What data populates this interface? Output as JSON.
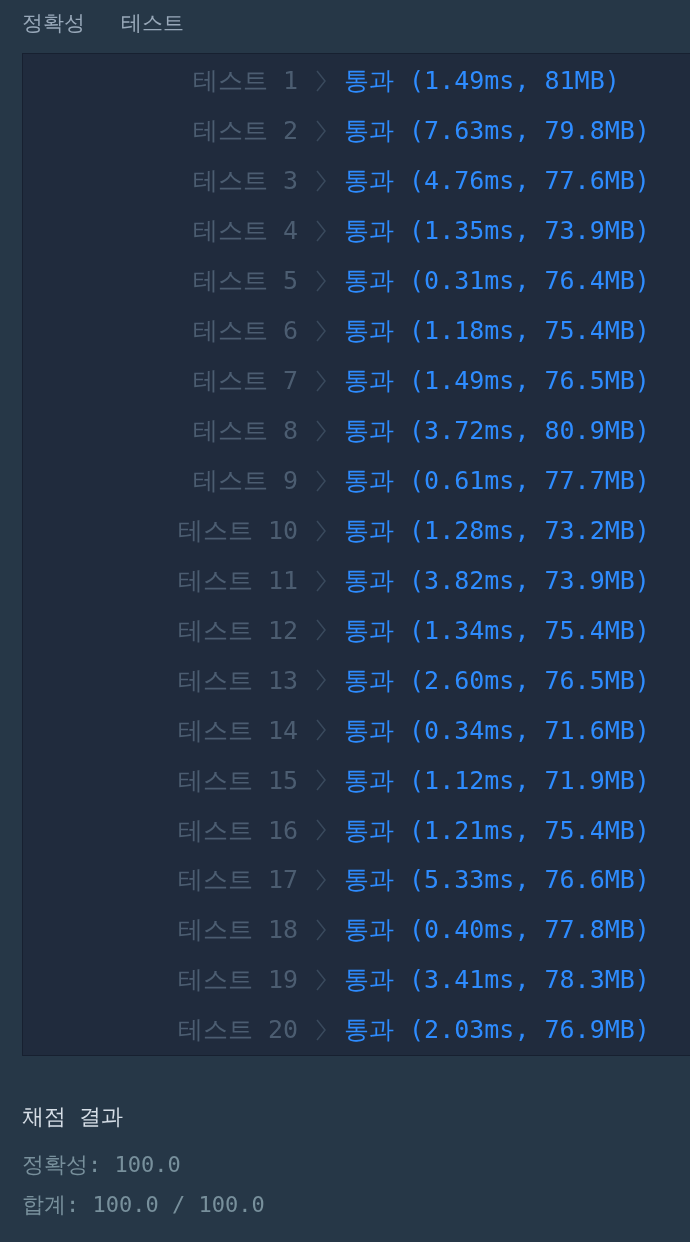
{
  "header": {
    "title": "정확성",
    "subtitle": "테스트"
  },
  "tests": [
    {
      "label": "테스트 1",
      "result": "통과 (1.49ms, 81MB)",
      "kind": "pass"
    },
    {
      "label": "테스트 2",
      "result": "통과 (7.63ms, 79.8MB)",
      "kind": "pass"
    },
    {
      "label": "테스트 3",
      "result": "통과 (4.76ms, 77.6MB)",
      "kind": "pass"
    },
    {
      "label": "테스트 4",
      "result": "통과 (1.35ms, 73.9MB)",
      "kind": "pass"
    },
    {
      "label": "테스트 5",
      "result": "통과 (0.31ms, 76.4MB)",
      "kind": "pass"
    },
    {
      "label": "테스트 6",
      "result": "통과 (1.18ms, 75.4MB)",
      "kind": "pass"
    },
    {
      "label": "테스트 7",
      "result": "통과 (1.49ms, 76.5MB)",
      "kind": "pass"
    },
    {
      "label": "테스트 8",
      "result": "통과 (3.72ms, 80.9MB)",
      "kind": "pass"
    },
    {
      "label": "테스트 9",
      "result": "통과 (0.61ms, 77.7MB)",
      "kind": "pass"
    },
    {
      "label": "테스트 10",
      "result": "통과 (1.28ms, 73.2MB)",
      "kind": "pass"
    },
    {
      "label": "테스트 11",
      "result": "통과 (3.82ms, 73.9MB)",
      "kind": "pass"
    },
    {
      "label": "테스트 12",
      "result": "통과 (1.34ms, 75.4MB)",
      "kind": "pass"
    },
    {
      "label": "테스트 13",
      "result": "통과 (2.60ms, 76.5MB)",
      "kind": "pass"
    },
    {
      "label": "테스트 14",
      "result": "통과 (0.34ms, 71.6MB)",
      "kind": "pass"
    },
    {
      "label": "테스트 15",
      "result": "통과 (1.12ms, 71.9MB)",
      "kind": "pass"
    },
    {
      "label": "테스트 16",
      "result": "통과 (1.21ms, 75.4MB)",
      "kind": "pass"
    },
    {
      "label": "테스트 17",
      "result": "통과 (5.33ms, 76.6MB)",
      "kind": "pass"
    },
    {
      "label": "테스트 18",
      "result": "통과 (0.40ms, 77.8MB)",
      "kind": "pass"
    },
    {
      "label": "테스트 19",
      "result": "통과 (3.41ms, 78.3MB)",
      "kind": "pass"
    },
    {
      "label": "테스트 20",
      "result": "통과 (2.03ms, 76.9MB)",
      "kind": "pass"
    }
  ],
  "summary": {
    "title": "채점 결과",
    "lines": [
      "정확성: 100.0",
      "합계: 100.0 / 100.0"
    ]
  }
}
